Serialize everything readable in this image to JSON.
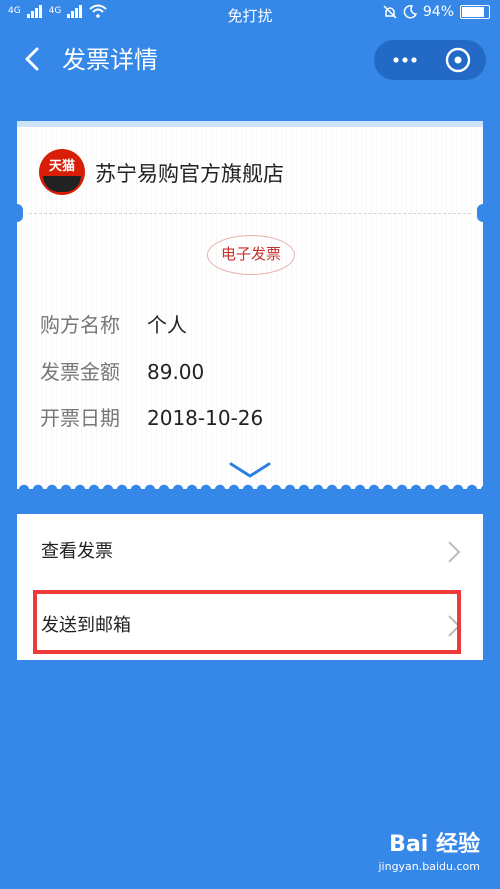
{
  "status_bar": {
    "signal_1": "4G",
    "signal_2": "4G",
    "mode": "免打扰",
    "battery": "94%",
    "battery_level": 0.94
  },
  "header": {
    "title": "发票详情",
    "back_icon": "chevron-left-icon",
    "more_icon": "more-icon",
    "close_icon": "close-circle-icon"
  },
  "invoice": {
    "store_logo_text": "天猫",
    "store_name": "苏宁易购官方旗舰店",
    "type_stamp": "电子发票",
    "rows": [
      {
        "label": "购方名称",
        "value": "个人"
      },
      {
        "label": "发票金额",
        "value": "89.00"
      },
      {
        "label": "开票日期",
        "value": "2018-10-26"
      }
    ],
    "expand_icon": "chevron-down-icon"
  },
  "actions": [
    {
      "label": "查看发票"
    },
    {
      "label": "发送到邮箱"
    }
  ],
  "watermark": {
    "brand": "Bai 经验",
    "url": "jingyan.baidu.com"
  },
  "colors": {
    "background": "#3587e8",
    "highlight": "#ee3a3a",
    "stamp": "#c9302c"
  }
}
